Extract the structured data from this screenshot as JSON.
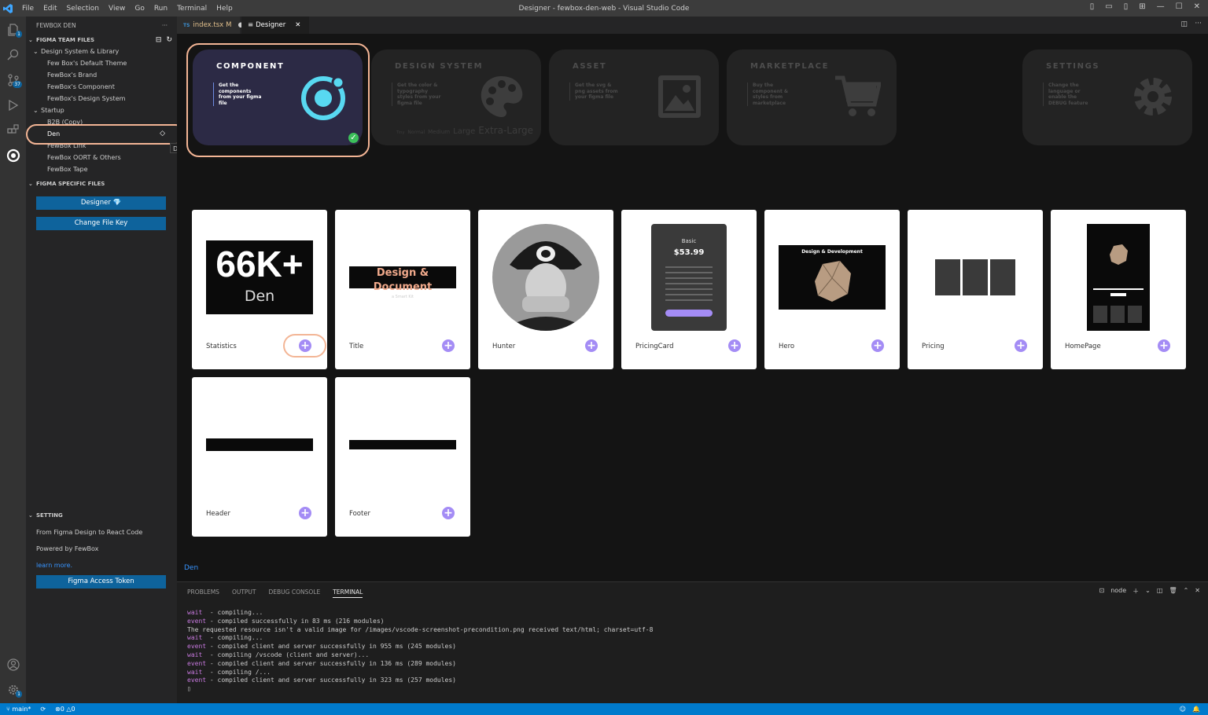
{
  "window": {
    "title": "Designer - fewbox-den-web - Visual Studio Code"
  },
  "menu": [
    "File",
    "Edit",
    "Selection",
    "View",
    "Go",
    "Run",
    "Terminal",
    "Help"
  ],
  "activity": {
    "source_control_badge": "37",
    "explorer_badge": "1",
    "settings_badge": "1"
  },
  "sidebar": {
    "title": "FEWBOX DEN",
    "team_files": {
      "header": "FIGMA TEAM FILES",
      "group1": {
        "label": "Design System & Library",
        "items": [
          "Few Box's Default Theme",
          "FewBox's Brand",
          "FewBox's Component",
          "FewBox's Design System"
        ]
      },
      "group2": {
        "label": "Startup",
        "items": [
          "B2B (Copy)",
          "Den",
          "FewBox Link",
          "FewBox OORT & Others",
          "FewBox Tape"
        ]
      }
    },
    "tooltip": "Den",
    "specific_files": {
      "header": "FIGMA SPECIFIC FILES",
      "designer_button": "Designer 💎",
      "change_key_button": "Change File Key"
    },
    "setting": {
      "header": "SETTING",
      "line1": "From Figma Design to React Code",
      "line2": "Powered by FewBox",
      "link": "learn more.",
      "token_button": "Figma Access Token"
    }
  },
  "tabs": [
    {
      "label": "index.tsx",
      "status": "M",
      "icon": "TS"
    },
    {
      "label": "Designer",
      "icon": "≡"
    }
  ],
  "features": [
    {
      "title": "COMPONENT",
      "desc": "Get the components from your figma file",
      "icon": "ionic-icon"
    },
    {
      "title": "DESIGN SYSTEM",
      "desc": "Get the color & typography styles from your figma file",
      "icon": "palette-icon",
      "sizes": [
        "Tiny",
        "Normal",
        "Medium",
        "Large",
        "Extra-Large"
      ]
    },
    {
      "title": "ASSET",
      "desc": "Get the svg & png assets from your figma file",
      "icon": "image-icon"
    },
    {
      "title": "MARKETPLACE",
      "desc": "Buy the component & styles from marketplace",
      "icon": "cart-icon"
    },
    {
      "title": "SETTINGS",
      "desc": "Change the language or enable the DEBUG feature",
      "icon": "gear-icon"
    }
  ],
  "cards": {
    "names": [
      "Statistics",
      "Title",
      "Hunter",
      "PricingCard",
      "Hero",
      "Pricing",
      "HomePage",
      "Header",
      "Footer"
    ],
    "statistics": {
      "big": "66K+",
      "sub": "Den"
    },
    "title_banner": {
      "main": "Design & Document",
      "sub": "a Smart Kit"
    },
    "pricing": {
      "plan": "Basic",
      "price": "$53.99"
    },
    "hero": {
      "title": "Design & Development"
    }
  },
  "footer_link": "Den",
  "panel": {
    "tabs": [
      "PROBLEMS",
      "OUTPUT",
      "DEBUG CONSOLE",
      "TERMINAL"
    ],
    "shell": "node",
    "lines": [
      {
        "k": "wait",
        "t": "  - compiling..."
      },
      {
        "k": "event",
        "t": " - compiled successfully in 83 ms (216 modules)"
      },
      {
        "k": "",
        "t": "The requested resource isn't a valid image for /images/vscode-screenshot-precondition.png received text/html; charset=utf-8"
      },
      {
        "k": "wait",
        "t": "  - compiling..."
      },
      {
        "k": "event",
        "t": " - compiled client and server successfully in 955 ms (245 modules)"
      },
      {
        "k": "wait",
        "t": "  - compiling /vscode (client and server)..."
      },
      {
        "k": "event",
        "t": " - compiled client and server successfully in 136 ms (289 modules)"
      },
      {
        "k": "wait",
        "t": "  - compiling /..."
      },
      {
        "k": "event",
        "t": " - compiled client and server successfully in 323 ms (257 modules)"
      },
      {
        "k": "",
        "t": "▯"
      }
    ]
  },
  "status": {
    "branch": "main*",
    "errors": "0",
    "warnings": "0"
  }
}
